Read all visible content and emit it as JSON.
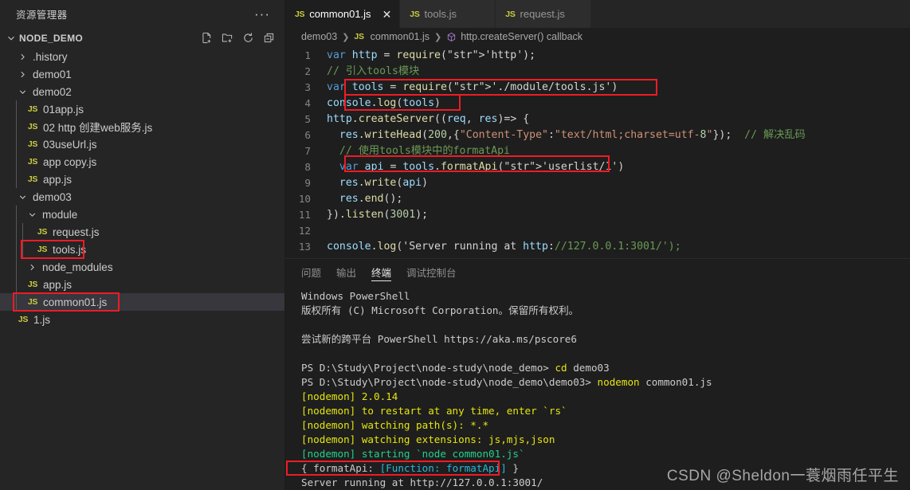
{
  "sidebar": {
    "title": "资源管理器",
    "more_label": "···",
    "root": {
      "label": "NODE_DEMO",
      "expanded": true
    },
    "actions": [
      {
        "name": "new-file-icon",
        "label": "新建文件"
      },
      {
        "name": "new-folder-icon",
        "label": "新建文件夹"
      },
      {
        "name": "refresh-icon",
        "label": "刷新资源管理器"
      },
      {
        "name": "collapse-all-icon",
        "label": "在资源管理器中折叠文件夹"
      }
    ],
    "items": [
      {
        "label": ".history",
        "type": "folder",
        "depth": 1,
        "expanded": false,
        "selected": false,
        "highlight": false
      },
      {
        "label": "demo01",
        "type": "folder",
        "depth": 1,
        "expanded": false,
        "selected": false,
        "highlight": false
      },
      {
        "label": "demo02",
        "type": "folder",
        "depth": 1,
        "expanded": true,
        "selected": false,
        "highlight": false
      },
      {
        "label": "01app.js",
        "type": "file",
        "depth": 2,
        "expanded": false,
        "selected": false,
        "highlight": false
      },
      {
        "label": "02 http 创建web服务.js",
        "type": "file",
        "depth": 2,
        "expanded": false,
        "selected": false,
        "highlight": false
      },
      {
        "label": "03useUrl.js",
        "type": "file",
        "depth": 2,
        "expanded": false,
        "selected": false,
        "highlight": false
      },
      {
        "label": "app copy.js",
        "type": "file",
        "depth": 2,
        "expanded": false,
        "selected": false,
        "highlight": false
      },
      {
        "label": "app.js",
        "type": "file",
        "depth": 2,
        "expanded": false,
        "selected": false,
        "highlight": false
      },
      {
        "label": "demo03",
        "type": "folder",
        "depth": 1,
        "expanded": true,
        "selected": false,
        "highlight": false
      },
      {
        "label": "module",
        "type": "folder",
        "depth": 2,
        "expanded": true,
        "selected": false,
        "highlight": false
      },
      {
        "label": "request.js",
        "type": "file",
        "depth": 3,
        "expanded": false,
        "selected": false,
        "highlight": false
      },
      {
        "label": "tools.js",
        "type": "file",
        "depth": 3,
        "expanded": false,
        "selected": false,
        "highlight": true
      },
      {
        "label": "node_modules",
        "type": "folder",
        "depth": 2,
        "expanded": false,
        "selected": false,
        "highlight": false
      },
      {
        "label": "app.js",
        "type": "file",
        "depth": 2,
        "expanded": false,
        "selected": false,
        "highlight": false
      },
      {
        "label": "common01.js",
        "type": "file",
        "depth": 2,
        "expanded": false,
        "selected": true,
        "highlight": true
      },
      {
        "label": "1.js",
        "type": "file",
        "depth": 1,
        "expanded": false,
        "selected": false,
        "highlight": false
      }
    ]
  },
  "tabs": [
    {
      "label": "common01.js",
      "active": true,
      "close": "✕"
    },
    {
      "label": "tools.js",
      "active": false,
      "close": ""
    },
    {
      "label": "request.js",
      "active": false,
      "close": ""
    }
  ],
  "breadcrumb": {
    "folder": "demo03",
    "file": "common01.js",
    "symbol": "http.createServer() callback",
    "separator": "❯"
  },
  "editor": {
    "lines": [
      {
        "n": "1",
        "text": "var http = require('http');"
      },
      {
        "n": "2",
        "text": "// 引入tools模块"
      },
      {
        "n": "3",
        "text": "var tools = require('./module/tools.js')"
      },
      {
        "n": "4",
        "text": "console.log(tools)"
      },
      {
        "n": "5",
        "text": "http.createServer((req, res)=> {"
      },
      {
        "n": "6",
        "text": "  res.writeHead(200,{\"Content-Type\":\"text/html;charset=utf-8\"});  // 解决乱码"
      },
      {
        "n": "7",
        "text": "  // 使用tools模块中的formatApi"
      },
      {
        "n": "8",
        "text": "  var api = tools.formatApi('userlist/1')"
      },
      {
        "n": "9",
        "text": "  res.write(api)"
      },
      {
        "n": "10",
        "text": "  res.end();"
      },
      {
        "n": "11",
        "text": "}).listen(3001);"
      },
      {
        "n": "12",
        "text": ""
      },
      {
        "n": "13",
        "text": "console.log('Server running at http://127.0.0.1:3001/');"
      }
    ]
  },
  "panel": {
    "tabs": [
      {
        "label": "问题",
        "active": false
      },
      {
        "label": "输出",
        "active": false
      },
      {
        "label": "终端",
        "active": true
      },
      {
        "label": "调试控制台",
        "active": false
      }
    ],
    "terminal_lines": [
      "Windows PowerShell",
      "版权所有 (C) Microsoft Corporation。保留所有权利。",
      "",
      "尝试新的跨平台 PowerShell https://aka.ms/pscore6",
      "",
      "PS D:\\Study\\Project\\node-study\\node_demo> cd demo03",
      "PS D:\\Study\\Project\\node-study\\node_demo\\demo03> nodemon common01.js",
      "[nodemon] 2.0.14",
      "[nodemon] to restart at any time, enter `rs`",
      "[nodemon] watching path(s): *.*",
      "[nodemon] watching extensions: js,mjs,json",
      "[nodemon] starting `node common01.js`",
      "{ formatApi: [Function: formatApi] }",
      "Server running at http://127.0.0.1:3001/"
    ]
  },
  "watermark": {
    "text": "CSDN @Sheldon一蓑烟雨任平生"
  },
  "colors": {
    "highlight_red": "#ee1c25",
    "sidebar_bg": "#252526",
    "editor_bg": "#1e1e1e",
    "tab_active_bg": "#1e1e1e",
    "js_icon": "#cbcb41",
    "selection_bg": "#37373d"
  }
}
